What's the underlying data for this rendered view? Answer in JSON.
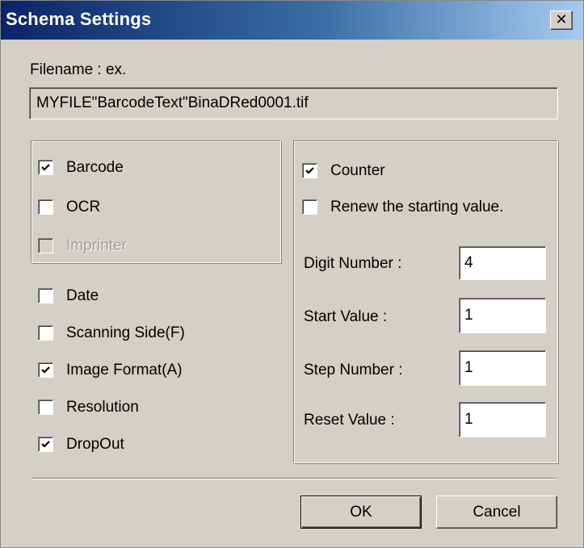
{
  "window": {
    "title": "Schema Settings",
    "close_glyph": "✕"
  },
  "filename": {
    "label": "Filename : ex.",
    "example": "MYFILE\"BarcodeText\"BinaDRed0001.tif"
  },
  "recognition_group": {
    "items": [
      {
        "label": "Barcode",
        "checked": true,
        "enabled": true
      },
      {
        "label": "OCR",
        "checked": false,
        "enabled": true
      },
      {
        "label": "Imprinter",
        "checked": false,
        "enabled": false
      }
    ]
  },
  "options": {
    "items": [
      {
        "label": "Date",
        "checked": false
      },
      {
        "label": "Scanning Side(F)",
        "checked": false
      },
      {
        "label": "Image Format(A)",
        "checked": true
      },
      {
        "label": "Resolution",
        "checked": false
      },
      {
        "label": "DropOut",
        "checked": true
      }
    ]
  },
  "counter_group": {
    "counter": {
      "label": "Counter",
      "checked": true
    },
    "renew": {
      "label": "Renew the starting value.",
      "checked": false
    },
    "fields": [
      {
        "label": "Digit Number :",
        "value": "4"
      },
      {
        "label": "Start Value :",
        "value": "1"
      },
      {
        "label": "Step Number :",
        "value": "1"
      },
      {
        "label": "Reset Value :",
        "value": "1"
      }
    ]
  },
  "buttons": {
    "ok": "OK",
    "cancel": "Cancel"
  }
}
